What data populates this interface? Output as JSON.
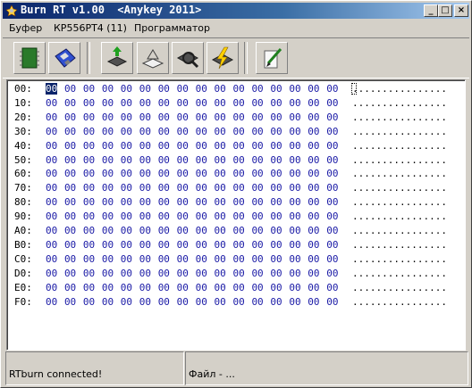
{
  "window": {
    "title": "Burn RT v1.00  <Anykey 2011>",
    "controls": {
      "minimize": "_",
      "maximize": "□",
      "close": "×"
    }
  },
  "menu": {
    "items": [
      {
        "label": "Буфер"
      },
      {
        "label": "КР556РТ4 (11)"
      },
      {
        "label": "Программатор"
      }
    ]
  },
  "toolbar": {
    "buttons": [
      {
        "icon": "chip-green-icon"
      },
      {
        "icon": "floppy-disk-icon"
      },
      {
        "icon": "chip-read-icon"
      },
      {
        "icon": "chip-blank-icon"
      },
      {
        "icon": "chip-verify-icon"
      },
      {
        "icon": "chip-write-icon"
      },
      {
        "icon": "erase-icon"
      }
    ]
  },
  "hex": {
    "rows": [
      {
        "addr": "00:",
        "bytes": [
          "00",
          "00",
          "00",
          "00",
          "00",
          "00",
          "00",
          "00",
          "00",
          "00",
          "00",
          "00",
          "00",
          "00",
          "00",
          "00"
        ],
        "ascii": "................"
      },
      {
        "addr": "10:",
        "bytes": [
          "00",
          "00",
          "00",
          "00",
          "00",
          "00",
          "00",
          "00",
          "00",
          "00",
          "00",
          "00",
          "00",
          "00",
          "00",
          "00"
        ],
        "ascii": "................"
      },
      {
        "addr": "20:",
        "bytes": [
          "00",
          "00",
          "00",
          "00",
          "00",
          "00",
          "00",
          "00",
          "00",
          "00",
          "00",
          "00",
          "00",
          "00",
          "00",
          "00"
        ],
        "ascii": "................"
      },
      {
        "addr": "30:",
        "bytes": [
          "00",
          "00",
          "00",
          "00",
          "00",
          "00",
          "00",
          "00",
          "00",
          "00",
          "00",
          "00",
          "00",
          "00",
          "00",
          "00"
        ],
        "ascii": "................"
      },
      {
        "addr": "40:",
        "bytes": [
          "00",
          "00",
          "00",
          "00",
          "00",
          "00",
          "00",
          "00",
          "00",
          "00",
          "00",
          "00",
          "00",
          "00",
          "00",
          "00"
        ],
        "ascii": "................"
      },
      {
        "addr": "50:",
        "bytes": [
          "00",
          "00",
          "00",
          "00",
          "00",
          "00",
          "00",
          "00",
          "00",
          "00",
          "00",
          "00",
          "00",
          "00",
          "00",
          "00"
        ],
        "ascii": "................"
      },
      {
        "addr": "60:",
        "bytes": [
          "00",
          "00",
          "00",
          "00",
          "00",
          "00",
          "00",
          "00",
          "00",
          "00",
          "00",
          "00",
          "00",
          "00",
          "00",
          "00"
        ],
        "ascii": "................"
      },
      {
        "addr": "70:",
        "bytes": [
          "00",
          "00",
          "00",
          "00",
          "00",
          "00",
          "00",
          "00",
          "00",
          "00",
          "00",
          "00",
          "00",
          "00",
          "00",
          "00"
        ],
        "ascii": "................"
      },
      {
        "addr": "80:",
        "bytes": [
          "00",
          "00",
          "00",
          "00",
          "00",
          "00",
          "00",
          "00",
          "00",
          "00",
          "00",
          "00",
          "00",
          "00",
          "00",
          "00"
        ],
        "ascii": "................"
      },
      {
        "addr": "90:",
        "bytes": [
          "00",
          "00",
          "00",
          "00",
          "00",
          "00",
          "00",
          "00",
          "00",
          "00",
          "00",
          "00",
          "00",
          "00",
          "00",
          "00"
        ],
        "ascii": "................"
      },
      {
        "addr": "A0:",
        "bytes": [
          "00",
          "00",
          "00",
          "00",
          "00",
          "00",
          "00",
          "00",
          "00",
          "00",
          "00",
          "00",
          "00",
          "00",
          "00",
          "00"
        ],
        "ascii": "................"
      },
      {
        "addr": "B0:",
        "bytes": [
          "00",
          "00",
          "00",
          "00",
          "00",
          "00",
          "00",
          "00",
          "00",
          "00",
          "00",
          "00",
          "00",
          "00",
          "00",
          "00"
        ],
        "ascii": "................"
      },
      {
        "addr": "C0:",
        "bytes": [
          "00",
          "00",
          "00",
          "00",
          "00",
          "00",
          "00",
          "00",
          "00",
          "00",
          "00",
          "00",
          "00",
          "00",
          "00",
          "00"
        ],
        "ascii": "................"
      },
      {
        "addr": "D0:",
        "bytes": [
          "00",
          "00",
          "00",
          "00",
          "00",
          "00",
          "00",
          "00",
          "00",
          "00",
          "00",
          "00",
          "00",
          "00",
          "00",
          "00"
        ],
        "ascii": "................"
      },
      {
        "addr": "E0:",
        "bytes": [
          "00",
          "00",
          "00",
          "00",
          "00",
          "00",
          "00",
          "00",
          "00",
          "00",
          "00",
          "00",
          "00",
          "00",
          "00",
          "00"
        ],
        "ascii": "................"
      },
      {
        "addr": "F0:",
        "bytes": [
          "00",
          "00",
          "00",
          "00",
          "00",
          "00",
          "00",
          "00",
          "00",
          "00",
          "00",
          "00",
          "00",
          "00",
          "00",
          "00"
        ],
        "ascii": "................"
      }
    ],
    "byte_color": "#1a1aa6",
    "selection_color": "#0a246a"
  },
  "status": {
    "connection": "RTburn connected!",
    "file": "Файл - ..."
  }
}
